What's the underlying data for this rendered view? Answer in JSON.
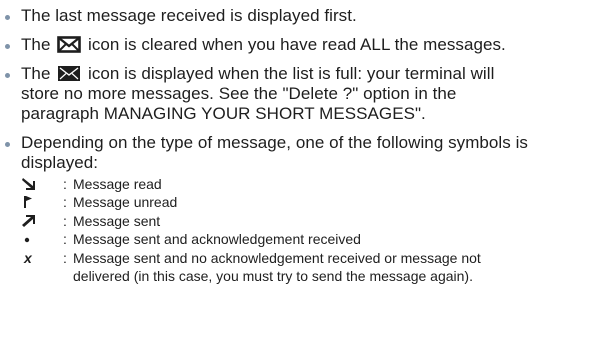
{
  "bullets": [
    {
      "lines": [
        "The last message received is displayed first."
      ]
    },
    {
      "before_icon": "The",
      "icon": "envelope-outline-icon",
      "after_icon": "icon is cleared when you have read ALL the messages."
    },
    {
      "before_icon": "The",
      "icon": "envelope-filled-icon",
      "after_icon": "icon is displayed when the list is full: your terminal will",
      "lines": [
        "store no more messages. See the \"Delete ?\" option in the",
        "paragraph MANAGING YOUR SHORT MESSAGES\"."
      ]
    },
    {
      "lines": [
        "Depending on the type of message, one of the following symbols is",
        "displayed:"
      ]
    }
  ],
  "symbols": [
    {
      "icon": "message-read-arrow-icon",
      "label": "Message read"
    },
    {
      "icon": "message-unread-flag-icon",
      "label": "Message unread"
    },
    {
      "icon": "message-sent-arrow-icon",
      "label": "Message sent"
    },
    {
      "icon": "dot-icon",
      "label": "Message sent and acknowledgement received"
    },
    {
      "glyph": "x",
      "label_lines": [
        "Message sent and no acknowledgement received or message not",
        "delivered (in this case, you must try to send the message again)."
      ]
    }
  ],
  "colon": ":",
  "colors": {
    "text": "#1e1e1e",
    "bullet": "#7f93a9"
  }
}
